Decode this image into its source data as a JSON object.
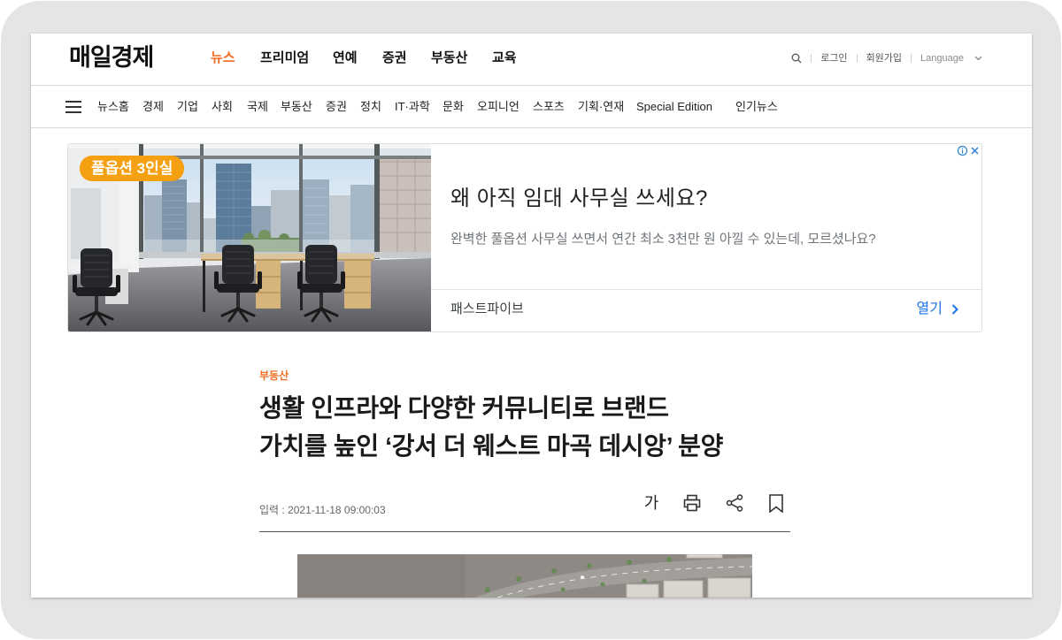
{
  "header": {
    "logo": "매일경제",
    "nav": [
      {
        "label": "뉴스",
        "active": true
      },
      {
        "label": "프리미엄"
      },
      {
        "label": "연예"
      },
      {
        "label": "증권"
      },
      {
        "label": "부동산"
      },
      {
        "label": "교육"
      }
    ],
    "utility": {
      "search_icon": "search-icon",
      "login": "로그인",
      "signup": "회원가입",
      "language": "Language",
      "language_icon": "chevron-down-icon"
    }
  },
  "subnav": {
    "menu_icon": "hamburger-menu-icon",
    "items": [
      "뉴스홈",
      "경제",
      "기업",
      "사회",
      "국제",
      "부동산",
      "증권",
      "정치",
      "IT·과학",
      "문화",
      "오피니언",
      "스포츠",
      "기획·연재",
      "Special Edition",
      "인기뉴스"
    ]
  },
  "ad": {
    "badge": "풀옵션 3인실",
    "headline": "왜 아직 임대 사무실 쓰세요?",
    "description": "완벽한 풀옵션 사무실 쓰면서 연간 최소 3천만 원 아낄 수 있는데, 모르셨나요?",
    "advertiser": "패스트파이브",
    "cta": "열기",
    "icons": {
      "info": "ad-info-icon",
      "close": "ad-close-icon",
      "cta": "chevron-right-icon"
    }
  },
  "article": {
    "category": "부동산",
    "title_lines": [
      "생활 인프라와 다양한 커뮤니티로 브랜드",
      "가치를 높인 ‘강서 더 웨스트 마곡 데시앙’ 분양"
    ],
    "published": "입력 : 2021-11-18 09:00:03",
    "tools": {
      "font_size": "가",
      "print_icon": "print-icon",
      "share_icon": "share-icon",
      "bookmark_icon": "bookmark-icon"
    }
  },
  "colors": {
    "accent": "#f26d21",
    "ad_link": "#1a73e8",
    "ad_badge": "#f5a011"
  }
}
